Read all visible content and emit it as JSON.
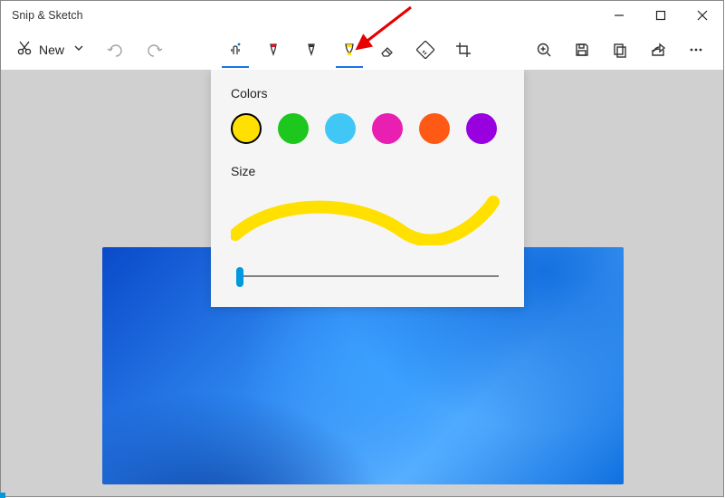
{
  "title": "Snip & Sketch",
  "toolbar": {
    "new_label": "New"
  },
  "popover": {
    "colors_label": "Colors",
    "size_label": "Size",
    "swatches": [
      {
        "name": "yellow",
        "hex": "#ffe000",
        "selected": true
      },
      {
        "name": "green",
        "hex": "#1dc71d",
        "selected": false
      },
      {
        "name": "sky-blue",
        "hex": "#40c7f5",
        "selected": false
      },
      {
        "name": "magenta",
        "hex": "#e81fb0",
        "selected": false
      },
      {
        "name": "orange",
        "hex": "#ff5a15",
        "selected": false
      },
      {
        "name": "purple",
        "hex": "#9800e0",
        "selected": false
      }
    ],
    "stroke_color": "#ffe000",
    "slider_value": 0,
    "slider_thumb_color": "#0099dd"
  }
}
